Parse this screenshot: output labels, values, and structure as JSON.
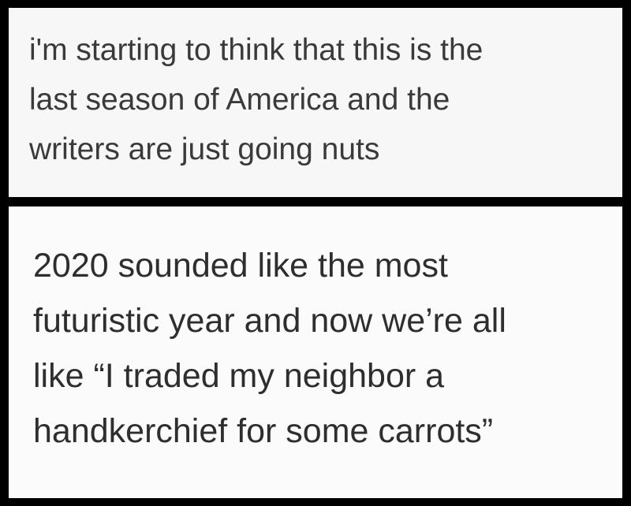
{
  "tweets": [
    {
      "lines": [
        "i'm starting to think that this is the",
        "last season of America and the",
        "writers are just going nuts"
      ]
    },
    {
      "lines": [
        "2020 sounded like the most",
        "futuristic year and now we’re all",
        "like “I traded my neighbor a",
        "handkerchief for some carrots”"
      ]
    }
  ],
  "colors": {
    "background": "#000000",
    "panel": "#f7f7f7",
    "text": "#3a3a3a"
  }
}
